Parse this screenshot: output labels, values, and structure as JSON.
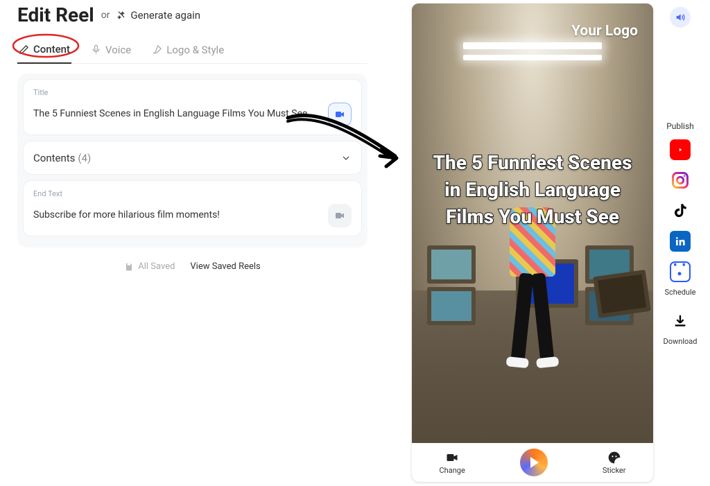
{
  "header": {
    "title": "Edit Reel",
    "or": "or",
    "generate_again": "Generate again"
  },
  "tabs": {
    "content": "Content",
    "voice": "Voice",
    "logo_style": "Logo & Style"
  },
  "title_card": {
    "label": "Title",
    "text": "The 5 Funniest Scenes in English Language Films You Must See"
  },
  "contents": {
    "label": "Contents",
    "count": "(4)"
  },
  "end_card": {
    "label": "End Text",
    "text": "Subscribe for more hilarious film moments!"
  },
  "status": {
    "all_saved": "All Saved",
    "view_saved": "View Saved Reels"
  },
  "preview": {
    "logo": "Your Logo",
    "overlay": "The 5 Funniest Scenes in English Language Films You Must See",
    "toolbar": {
      "change": "Change",
      "sticker": "Sticker"
    }
  },
  "rail": {
    "publish": "Publish",
    "schedule": "Schedule",
    "download": "Download"
  }
}
